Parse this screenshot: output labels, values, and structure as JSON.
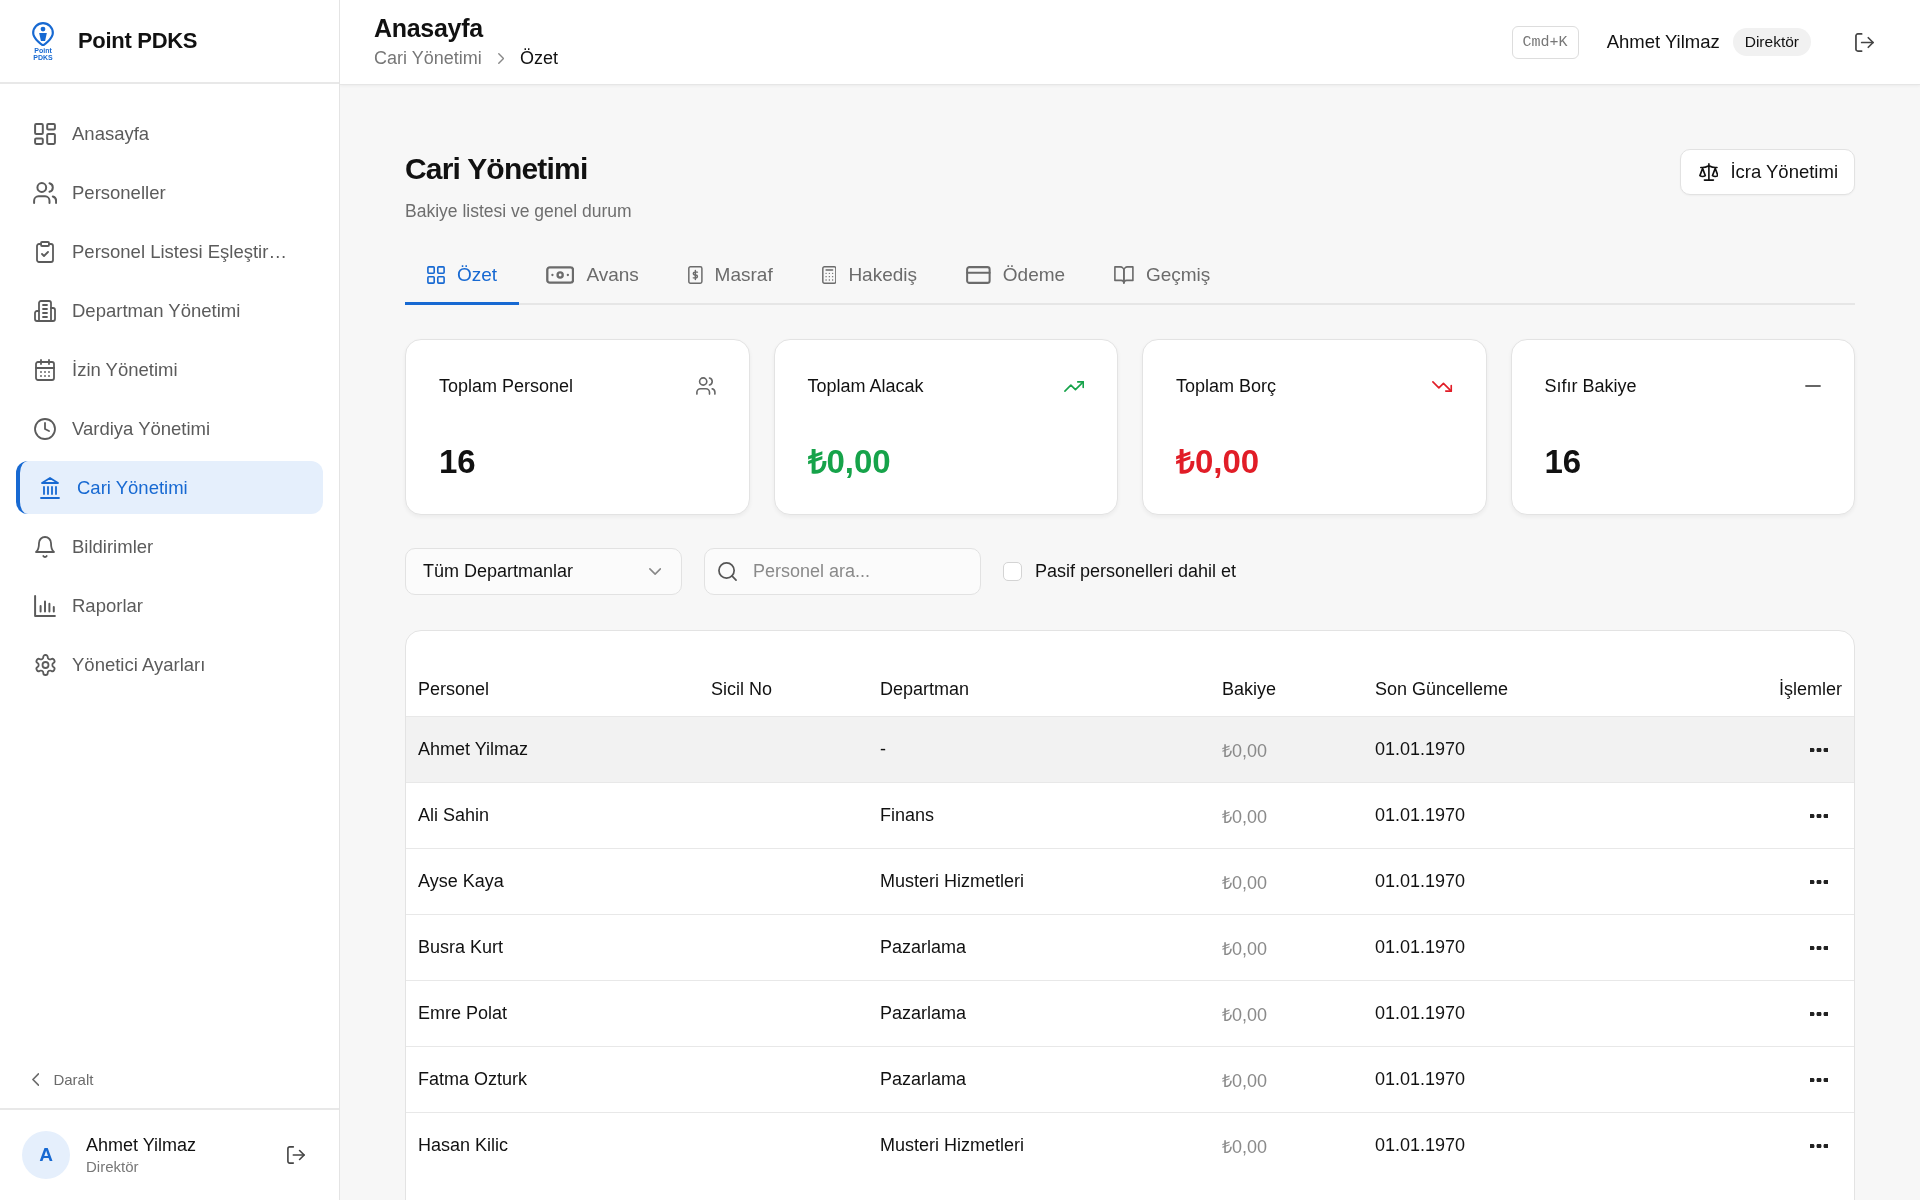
{
  "sidebar": {
    "brand": "Point PDKS",
    "logo_caption": "Point PDKS",
    "items": [
      {
        "label": "Anasayfa",
        "selected": false
      },
      {
        "label": "Personeller",
        "selected": false
      },
      {
        "label": "Personel Listesi Eşleştir…",
        "selected": false
      },
      {
        "label": "Departman Yönetimi",
        "selected": false
      },
      {
        "label": "İzin Yönetimi",
        "selected": false
      },
      {
        "label": "Vardiya Yönetimi",
        "selected": false
      },
      {
        "label": "Cari Yönetimi",
        "selected": true
      },
      {
        "label": "Bildirimler",
        "selected": false
      },
      {
        "label": "Raporlar",
        "selected": false
      },
      {
        "label": "Yönetici Ayarları",
        "selected": false
      }
    ],
    "collapse": "Daralt",
    "user": {
      "initial": "A",
      "name": "Ahmet Yilmaz",
      "role": "Direktör"
    }
  },
  "header": {
    "title": "Anasayfa",
    "breadcrumb": [
      "Cari Yönetimi",
      "Özet"
    ],
    "shortcut": "Cmd+K",
    "user_name": "Ahmet Yilmaz",
    "role": "Direktör"
  },
  "page": {
    "title": "Cari Yönetimi",
    "subtitle": "Bakiye listesi ve genel durum",
    "action": "İcra Yönetimi"
  },
  "tabs": [
    {
      "label": "Özet",
      "selected": true
    },
    {
      "label": "Avans",
      "selected": false
    },
    {
      "label": "Masraf",
      "selected": false
    },
    {
      "label": "Hakediş",
      "selected": false
    },
    {
      "label": "Ödeme",
      "selected": false
    },
    {
      "label": "Geçmiş",
      "selected": false
    }
  ],
  "stats": [
    {
      "kind": "count",
      "label": "Toplam Personel",
      "value": "16"
    },
    {
      "kind": "credit",
      "label": "Toplam Alacak",
      "value": "₺0,00"
    },
    {
      "kind": "debt",
      "label": "Toplam Borç",
      "value": "₺0,00"
    },
    {
      "kind": "zero",
      "label": "Sıfır Bakiye",
      "value": "16"
    }
  ],
  "filters": {
    "department": {
      "value": "Tüm Departmanlar"
    },
    "search": {
      "placeholder": "Personel ara..."
    },
    "include_passive": {
      "label": "Pasif personelleri dahil et",
      "checked": false
    }
  },
  "table": {
    "columns": [
      "Personel",
      "Sicil No",
      "Departman",
      "Bakiye",
      "Son Güncelleme",
      "İşlemler"
    ],
    "rows": [
      {
        "personel": "Ahmet Yilmaz",
        "departman": "-",
        "bakiye": "₺0,00",
        "son_guncelleme": "01.01.1970",
        "hovered": true
      },
      {
        "personel": "Ali Sahin",
        "departman": "Finans",
        "bakiye": "₺0,00",
        "son_guncelleme": "01.01.1970",
        "hovered": false
      },
      {
        "personel": "Ayse Kaya",
        "departman": "Musteri Hizmetleri",
        "bakiye": "₺0,00",
        "son_guncelleme": "01.01.1970",
        "hovered": false
      },
      {
        "personel": "Busra Kurt",
        "departman": "Pazarlama",
        "bakiye": "₺0,00",
        "son_guncelleme": "01.01.1970",
        "hovered": false
      },
      {
        "personel": "Emre Polat",
        "departman": "Pazarlama",
        "bakiye": "₺0,00",
        "son_guncelleme": "01.01.1970",
        "hovered": false
      },
      {
        "personel": "Fatma Ozturk",
        "departman": "Pazarlama",
        "bakiye": "₺0,00",
        "son_guncelleme": "01.01.1970",
        "hovered": false
      },
      {
        "personel": "Hasan Kilic",
        "departman": "Musteri Hizmetleri",
        "bakiye": "₺0,00",
        "son_guncelleme": "01.01.1970",
        "hovered": false
      }
    ]
  }
}
